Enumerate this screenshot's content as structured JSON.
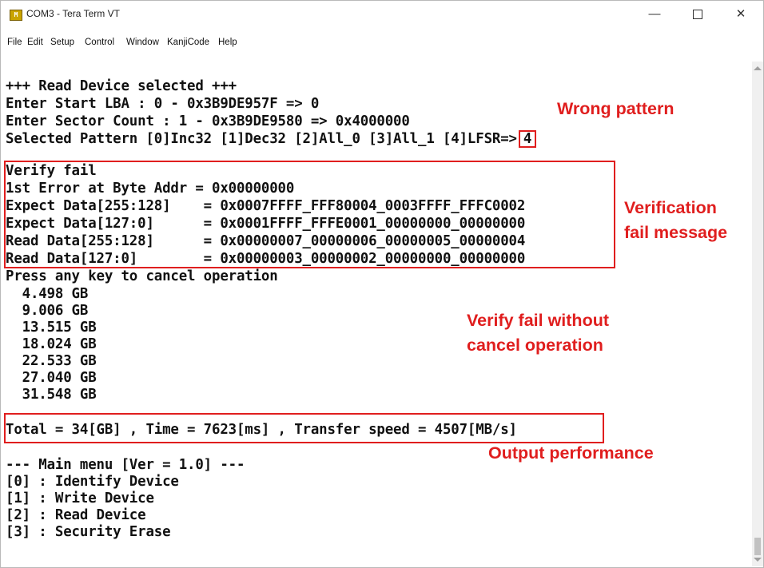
{
  "window": {
    "title": "COM3 - Tera Term VT",
    "icon_label": "M",
    "controls": {
      "minimize": "—",
      "close": "✕"
    }
  },
  "menu": [
    "File",
    "Edit",
    "Setup",
    "Control",
    "Window",
    "KanjiCode",
    "Help"
  ],
  "terminal": {
    "header": "+++ Read Device selected +++",
    "start_lba": "Enter Start LBA : 0 - 0x3B9DE957F => 0",
    "sector_count": "Enter Sector Count : 1 - 0x3B9DE9580 => 0x4000000",
    "pattern_prompt": "Selected Pattern [0]Inc32 [1]Dec32 [2]All_0 [3]All_1 [4]LFSR=>",
    "pattern_value": "4",
    "verify_fail": "Verify fail",
    "first_error": "1st Error at Byte Addr = 0x00000000",
    "expect_hi": "Expect Data[255:128]    = 0x0007FFFF_FFF80004_0003FFFF_FFFC0002",
    "expect_lo": "Expect Data[127:0]      = 0x0001FFFF_FFFE0001_00000000_00000000",
    "read_hi": "Read Data[255:128]      = 0x00000007_00000006_00000005_00000004",
    "read_lo": "Read Data[127:0]        = 0x00000003_00000002_00000000_00000000",
    "press_key": "Press any key to cancel operation",
    "progress": [
      "  4.498 GB",
      "  9.006 GB",
      "  13.515 GB",
      "  18.024 GB",
      "  22.533 GB",
      "  27.040 GB",
      "  31.548 GB"
    ],
    "total": "Total = 34[GB] , Time = 7623[ms] , Transfer speed = 4507[MB/s]",
    "main_menu": "--- Main menu [Ver = 1.0] ---",
    "menu_items": [
      "[0] : Identify Device",
      "[1] : Write Device",
      "[2] : Read Device",
      "[3] : Security Erase"
    ]
  },
  "annotations": {
    "wrong_pattern": "Wrong pattern",
    "verification_1": "Verification",
    "verification_2": "fail message",
    "no_cancel_1": "Verify fail without",
    "no_cancel_2": "cancel operation",
    "output_perf": "Output performance"
  },
  "colors": {
    "annotation": "#e01e1e",
    "text": "#111111",
    "background": "#ffffff"
  }
}
